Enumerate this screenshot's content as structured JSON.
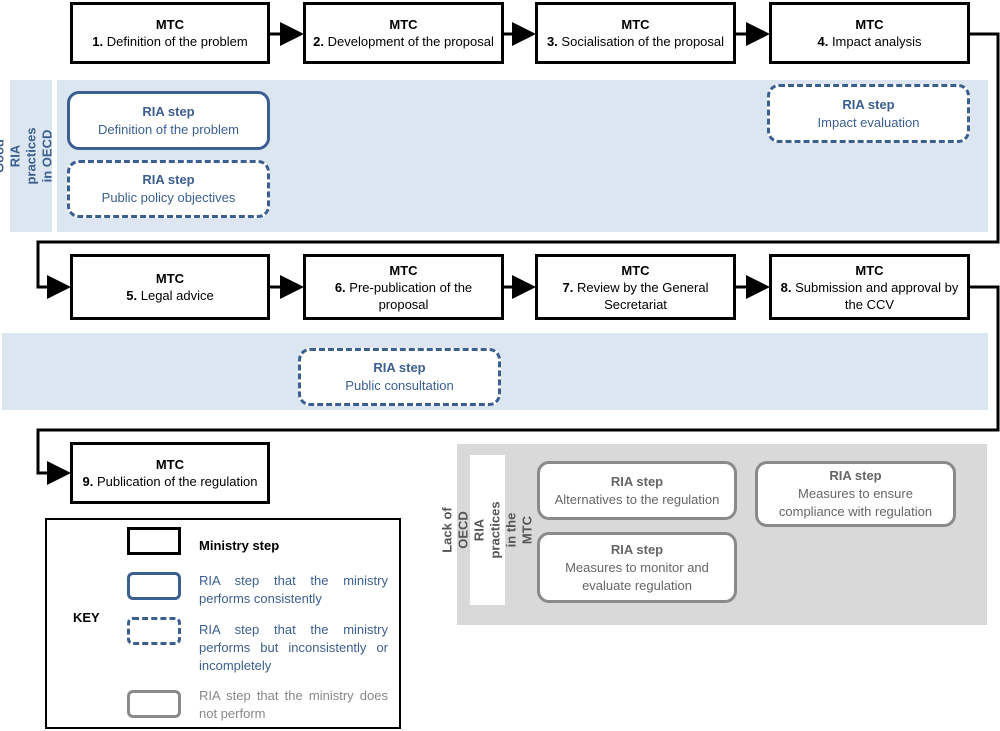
{
  "ministry_steps": [
    {
      "org": "MTC",
      "num": "1.",
      "label": "Definition of the problem"
    },
    {
      "org": "MTC",
      "num": "2.",
      "label": "Development of the proposal"
    },
    {
      "org": "MTC",
      "num": "3.",
      "label": "Socialisation of the proposal"
    },
    {
      "org": "MTC",
      "num": "4.",
      "label": "Impact analysis"
    },
    {
      "org": "MTC",
      "num": "5.",
      "label": "Legal advice"
    },
    {
      "org": "MTC",
      "num": "6.",
      "label": "Pre-publication of the proposal"
    },
    {
      "org": "MTC",
      "num": "7.",
      "label": "Review by the General Secretariat"
    },
    {
      "org": "MTC",
      "num": "8.",
      "label": "Submission and approval by the CCV"
    },
    {
      "org": "MTC",
      "num": "9.",
      "label": "Publication of the regulation"
    }
  ],
  "good_practices_label": "Good RIA practices in OECD countries",
  "lack_practices_label": "Lack of OECD RIA practices in the MTC",
  "ria_steps": [
    {
      "heading": "RIA step",
      "label": "Definition of the problem",
      "status": "consistent"
    },
    {
      "heading": "RIA step",
      "label": "Public policy objectives",
      "status": "inconsistent"
    },
    {
      "heading": "RIA step",
      "label": "Impact evaluation",
      "status": "inconsistent"
    },
    {
      "heading": "RIA step",
      "label": "Public consultation",
      "status": "inconsistent"
    },
    {
      "heading": "RIA step",
      "label": "Alternatives to the regulation",
      "status": "not-performed"
    },
    {
      "heading": "RIA step",
      "label": "Measures to ensure compliance with regulation",
      "status": "not-performed"
    },
    {
      "heading": "RIA step",
      "label": "Measures to monitor and evaluate regulation",
      "status": "not-performed"
    }
  ],
  "key": {
    "title": "KEY",
    "items": [
      {
        "label": "Ministry step"
      },
      {
        "label": "RIA step that the ministry performs consistently"
      },
      {
        "label": "RIA step that the ministry performs but inconsistently or incompletely"
      },
      {
        "label": "RIA step that the ministry does not perform"
      }
    ]
  },
  "colors": {
    "ria_blue": "#3b5f8f",
    "band": "#dce6f1",
    "gray_panel": "#d9d9d9",
    "gray_border": "#8a8a8a"
  }
}
